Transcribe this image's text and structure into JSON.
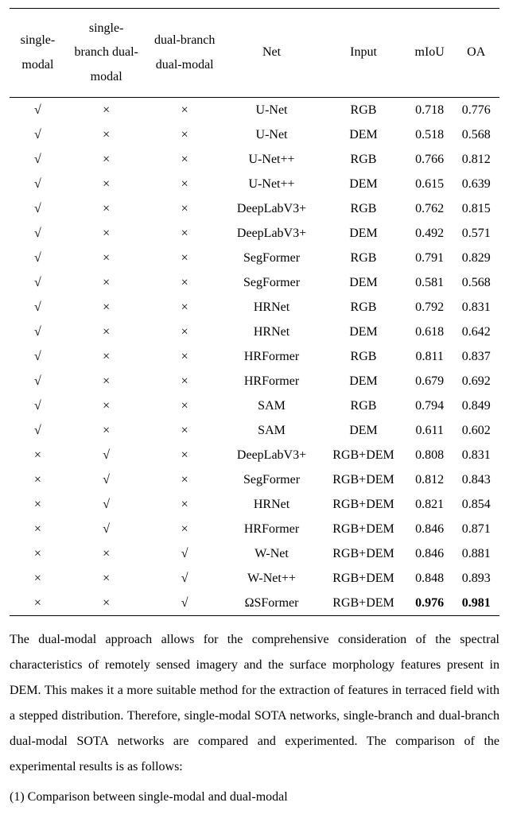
{
  "table": {
    "headers": [
      "single-\nmodal",
      "single-\nbranch dual-\nmodal",
      "dual-branch\ndual-modal",
      "Net",
      "Input",
      "mIoU",
      "OA"
    ],
    "rows": [
      {
        "sm": "√",
        "sbd": "×",
        "dbd": "×",
        "net": "U-Net",
        "input": "RGB",
        "miou": "0.718",
        "oa": "0.776"
      },
      {
        "sm": "√",
        "sbd": "×",
        "dbd": "×",
        "net": "U-Net",
        "input": "DEM",
        "miou": "0.518",
        "oa": "0.568"
      },
      {
        "sm": "√",
        "sbd": "×",
        "dbd": "×",
        "net": "U-Net++",
        "input": "RGB",
        "miou": "0.766",
        "oa": "0.812"
      },
      {
        "sm": "√",
        "sbd": "×",
        "dbd": "×",
        "net": "U-Net++",
        "input": "DEM",
        "miou": "0.615",
        "oa": "0.639"
      },
      {
        "sm": "√",
        "sbd": "×",
        "dbd": "×",
        "net": "DeepLabV3+",
        "input": "RGB",
        "miou": "0.762",
        "oa": "0.815"
      },
      {
        "sm": "√",
        "sbd": "×",
        "dbd": "×",
        "net": "DeepLabV3+",
        "input": "DEM",
        "miou": "0.492",
        "oa": "0.571"
      },
      {
        "sm": "√",
        "sbd": "×",
        "dbd": "×",
        "net": "SegFormer",
        "input": "RGB",
        "miou": "0.791",
        "oa": "0.829"
      },
      {
        "sm": "√",
        "sbd": "×",
        "dbd": "×",
        "net": "SegFormer",
        "input": "DEM",
        "miou": "0.581",
        "oa": "0.568"
      },
      {
        "sm": "√",
        "sbd": "×",
        "dbd": "×",
        "net": "HRNet",
        "input": "RGB",
        "miou": "0.792",
        "oa": "0.831"
      },
      {
        "sm": "√",
        "sbd": "×",
        "dbd": "×",
        "net": "HRNet",
        "input": "DEM",
        "miou": "0.618",
        "oa": "0.642"
      },
      {
        "sm": "√",
        "sbd": "×",
        "dbd": "×",
        "net": "HRFormer",
        "input": "RGB",
        "miou": "0.811",
        "oa": "0.837"
      },
      {
        "sm": "√",
        "sbd": "×",
        "dbd": "×",
        "net": "HRFormer",
        "input": "DEM",
        "miou": "0.679",
        "oa": "0.692"
      },
      {
        "sm": "√",
        "sbd": "×",
        "dbd": "×",
        "net": "SAM",
        "input": "RGB",
        "miou": "0.794",
        "oa": "0.849"
      },
      {
        "sm": "√",
        "sbd": "×",
        "dbd": "×",
        "net": "SAM",
        "input": "DEM",
        "miou": "0.611",
        "oa": "0.602"
      },
      {
        "sm": "×",
        "sbd": "√",
        "dbd": "×",
        "net": "DeepLabV3+",
        "input": "RGB+DEM",
        "miou": "0.808",
        "oa": "0.831"
      },
      {
        "sm": "×",
        "sbd": "√",
        "dbd": "×",
        "net": "SegFormer",
        "input": "RGB+DEM",
        "miou": "0.812",
        "oa": "0.843"
      },
      {
        "sm": "×",
        "sbd": "√",
        "dbd": "×",
        "net": "HRNet",
        "input": "RGB+DEM",
        "miou": "0.821",
        "oa": "0.854"
      },
      {
        "sm": "×",
        "sbd": "√",
        "dbd": "×",
        "net": "HRFormer",
        "input": "RGB+DEM",
        "miou": "0.846",
        "oa": "0.871"
      },
      {
        "sm": "×",
        "sbd": "×",
        "dbd": "√",
        "net": "W-Net",
        "input": "RGB+DEM",
        "miou": "0.846",
        "oa": "0.881"
      },
      {
        "sm": "×",
        "sbd": "×",
        "dbd": "√",
        "net": "W-Net++",
        "input": "RGB+DEM",
        "miou": "0.848",
        "oa": "0.893"
      },
      {
        "sm": "×",
        "sbd": "×",
        "dbd": "√",
        "net": "ΩSFormer",
        "input": "RGB+DEM",
        "miou": "0.976",
        "oa": "0.981",
        "bold_miou": true,
        "bold_oa": true
      }
    ]
  },
  "paragraph": "The dual-modal approach allows for the comprehensive consideration of the spectral characteristics of remotely sensed imagery and the surface morphology features present in DEM. This makes it a more suitable method for the extraction of features in terraced field with a stepped distribution. Therefore, single-modal SOTA networks, single-branch and dual-branch dual-modal SOTA networks are compared and experimented. The comparison of the experimental results is as follows:",
  "subhead": "(1) Comparison between single-modal and dual-modal"
}
